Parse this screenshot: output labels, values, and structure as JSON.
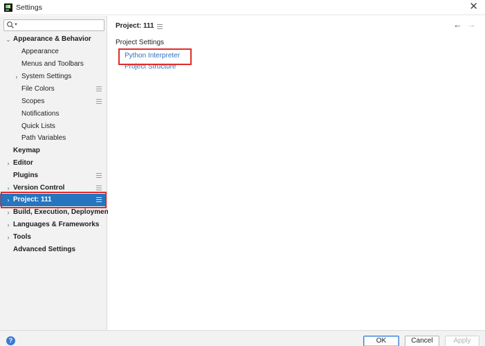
{
  "window": {
    "title": "Settings",
    "close_glyph": "✕",
    "icon": "pycharm-app-icon"
  },
  "search": {
    "value": "",
    "placeholder": "",
    "icon": "search-icon"
  },
  "sidebar": {
    "items": [
      {
        "label": "Appearance & Behavior",
        "level": 0,
        "bold": true,
        "expander": "expanded"
      },
      {
        "label": "Appearance",
        "level": 1
      },
      {
        "label": "Menus and Toolbars",
        "level": 1
      },
      {
        "label": "System Settings",
        "level": 1,
        "expander": "collapsed"
      },
      {
        "label": "File Colors",
        "level": 1,
        "settings_icon": true
      },
      {
        "label": "Scopes",
        "level": 1,
        "settings_icon": true
      },
      {
        "label": "Notifications",
        "level": 1
      },
      {
        "label": "Quick Lists",
        "level": 1
      },
      {
        "label": "Path Variables",
        "level": 1
      },
      {
        "label": "Keymap",
        "level": 0,
        "bold": true
      },
      {
        "label": "Editor",
        "level": 0,
        "bold": true,
        "expander": "collapsed"
      },
      {
        "label": "Plugins",
        "level": 0,
        "bold": true,
        "settings_icon": true
      },
      {
        "label": "Version Control",
        "level": 0,
        "bold": true,
        "expander": "collapsed",
        "settings_icon": true
      },
      {
        "label": "Project: 111",
        "level": 0,
        "bold": true,
        "expander": "collapsed",
        "settings_icon": true,
        "selected": true
      },
      {
        "label": "Build, Execution, Deployment",
        "level": 0,
        "bold": true,
        "expander": "collapsed"
      },
      {
        "label": "Languages & Frameworks",
        "level": 0,
        "bold": true,
        "expander": "collapsed"
      },
      {
        "label": "Tools",
        "level": 0,
        "bold": true,
        "expander": "collapsed"
      },
      {
        "label": "Advanced Settings",
        "level": 0,
        "bold": true
      }
    ]
  },
  "main": {
    "breadcrumb": "Project: 111",
    "back_glyph": "←",
    "forward_glyph": "→",
    "section_title": "Project Settings",
    "links": [
      "Python Interpreter",
      "Project Structure"
    ]
  },
  "footer": {
    "help_glyph": "?",
    "ok_label": "OK",
    "cancel_label": "Cancel",
    "apply_label": "Apply"
  },
  "colors": {
    "selection": "#2675bf",
    "link": "#2f6fbf",
    "highlight_box": "#e02a2a",
    "sidebar_bg": "#f2f2f2"
  }
}
